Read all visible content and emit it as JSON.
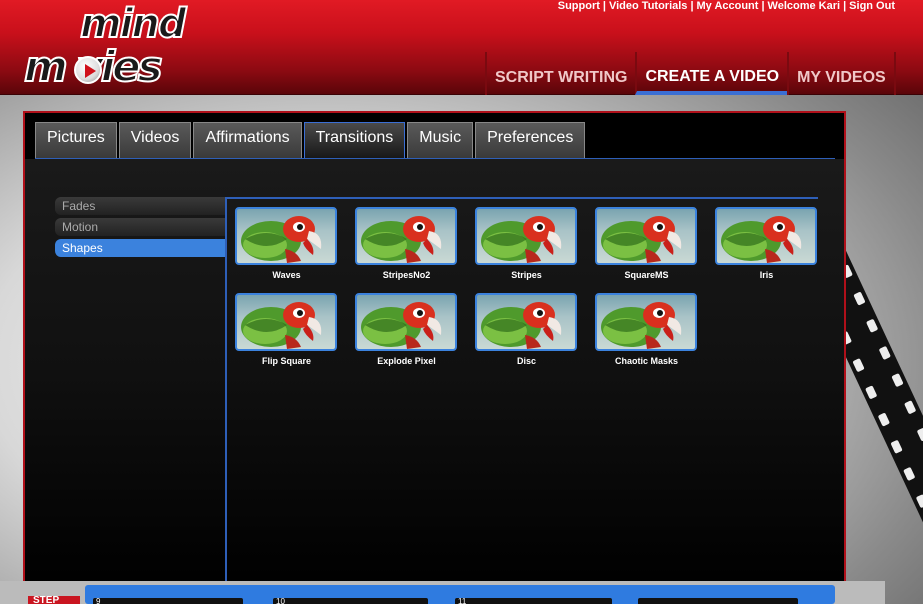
{
  "toplinks": [
    "Support",
    "Video Tutorials",
    "My Account",
    "Welcome Kari",
    "Sign Out"
  ],
  "logo": {
    "line1": "mind",
    "line2": "m vies"
  },
  "main_nav": [
    {
      "label": "SCRIPT WRITING"
    },
    {
      "label": "CREATE A VIDEO",
      "active": true
    },
    {
      "label": "MY VIDEOS"
    }
  ],
  "tabs": [
    {
      "label": "Pictures"
    },
    {
      "label": "Videos"
    },
    {
      "label": "Affirmations"
    },
    {
      "label": "Transitions",
      "active": true
    },
    {
      "label": "Music"
    },
    {
      "label": "Preferences"
    }
  ],
  "categories": [
    {
      "label": "Fades"
    },
    {
      "label": "Motion"
    },
    {
      "label": "Shapes",
      "active": true
    }
  ],
  "transitions": [
    {
      "name": "Waves"
    },
    {
      "name": "StripesNo2"
    },
    {
      "name": "Stripes"
    },
    {
      "name": "SquareMS"
    },
    {
      "name": "Iris"
    },
    {
      "name": "Flip Square"
    },
    {
      "name": "Explode Pixel"
    },
    {
      "name": "Disc"
    },
    {
      "name": "Chaotic Masks"
    }
  ],
  "storyboard": {
    "step_label": "STEP",
    "slots": [
      "9",
      "10",
      "11"
    ]
  },
  "colors": {
    "header_red": "#c9101b",
    "accent_blue": "#3b82dd",
    "panel_border": "#b0101a"
  }
}
